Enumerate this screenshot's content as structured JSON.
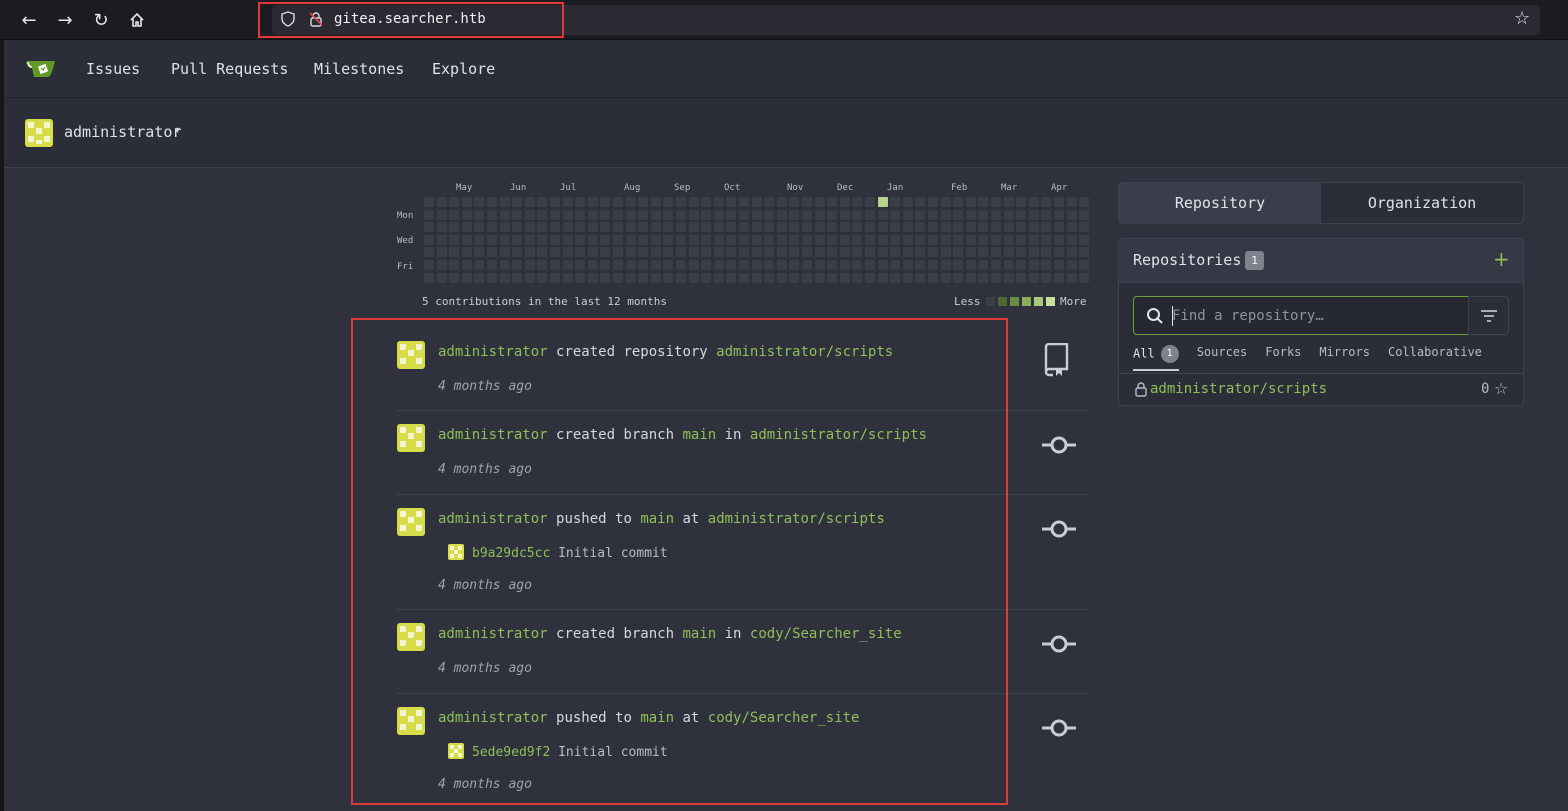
{
  "browser": {
    "url": "gitea.searcher.htb"
  },
  "navbar": {
    "items": [
      "Issues",
      "Pull Requests",
      "Milestones",
      "Explore"
    ]
  },
  "header": {
    "username": "administrator"
  },
  "heatmap": {
    "months": [
      "May",
      "Jun",
      "Jul",
      "Aug",
      "Sep",
      "Oct",
      "Nov",
      "Dec",
      "Jan",
      "Feb",
      "Mar",
      "Apr"
    ],
    "days": [
      "Mon",
      "Wed",
      "Fri"
    ],
    "summary": "5 contributions in the last 12 months",
    "legend_less": "Less",
    "legend_more": "More",
    "active_week_index": 36,
    "active_day_index": 0
  },
  "feed": {
    "items": [
      {
        "actor": "administrator",
        "action": "created repository",
        "target": "administrator/scripts",
        "time": "4 months ago",
        "icon": "repo-icon"
      },
      {
        "actor": "administrator",
        "action": "created branch",
        "branch": "main",
        "prep": "in",
        "target": "administrator/scripts",
        "time": "4 months ago",
        "icon": "commit-icon"
      },
      {
        "actor": "administrator",
        "action": "pushed to",
        "branch": "main",
        "prep": "at",
        "target": "administrator/scripts",
        "commit_sha": "b9a29dc5cc",
        "commit_msg": "Initial commit",
        "time": "4 months ago",
        "icon": "commit-icon"
      },
      {
        "actor": "administrator",
        "action": "created branch",
        "branch": "main",
        "prep": "in",
        "target": "cody/Searcher_site",
        "time": "4 months ago",
        "icon": "commit-icon"
      },
      {
        "actor": "administrator",
        "action": "pushed to",
        "branch": "main",
        "prep": "at",
        "target": "cody/Searcher_site",
        "commit_sha": "5ede9ed9f2",
        "commit_msg": "Initial commit",
        "time": "4 months ago",
        "icon": "commit-icon"
      }
    ]
  },
  "sidebar": {
    "tabs": [
      "Repository",
      "Organization"
    ],
    "repos_title": "Repositories",
    "repos_count": "1",
    "search_placeholder": "Find a repository…",
    "filters": [
      {
        "label": "All",
        "count": "1"
      },
      {
        "label": "Sources"
      },
      {
        "label": "Forks"
      },
      {
        "label": "Mirrors"
      },
      {
        "label": "Collaborative"
      }
    ],
    "repo": {
      "name": "administrator/scripts",
      "stars": "0"
    }
  },
  "colors": {
    "accent": "#8fbf57",
    "highlight_box": "#e03a3a",
    "background": "#2f323d"
  }
}
